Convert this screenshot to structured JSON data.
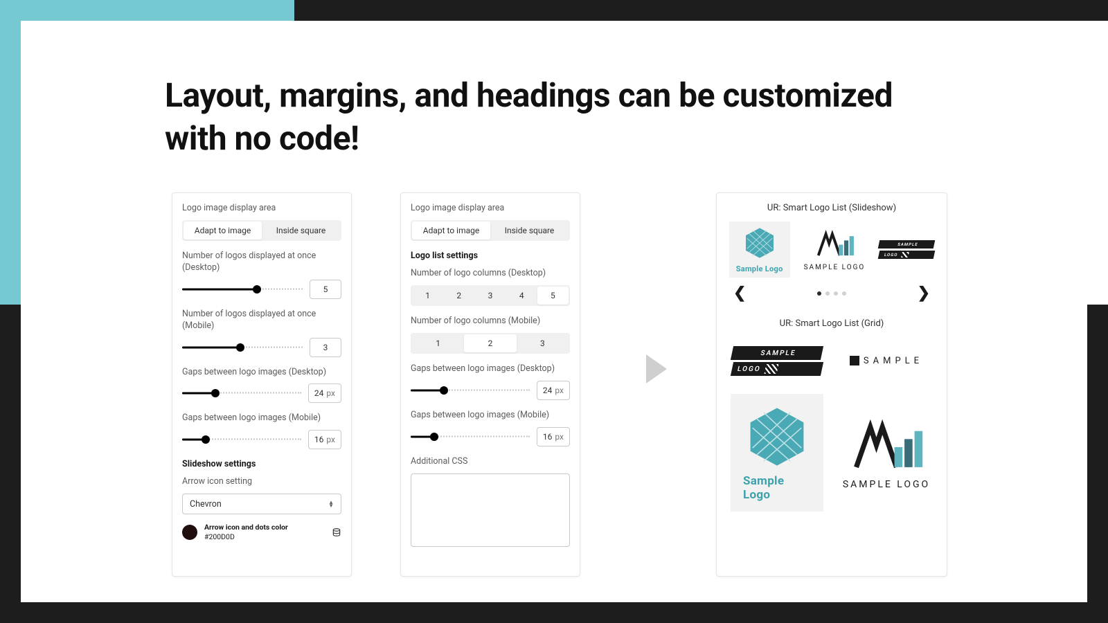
{
  "headline": "Layout, margins, and headings can be customized with no code!",
  "panel1": {
    "display_area_label": "Logo image display area",
    "seg_adapt": "Adapt to image",
    "seg_square": "Inside square",
    "num_desktop_label": "Number of logos displayed at once (Desktop)",
    "num_desktop_value": "5",
    "num_mobile_label": "Number of logos displayed at once (Mobile)",
    "num_mobile_value": "3",
    "gaps_desktop_label": "Gaps between logo images (Desktop)",
    "gaps_desktop_value": "24",
    "gaps_mobile_label": "Gaps between logo images (Mobile)",
    "gaps_mobile_value": "16",
    "px": "px",
    "slideshow_heading": "Slideshow settings",
    "arrow_icon_label": "Arrow icon setting",
    "arrow_icon_value": "Chevron",
    "color_label": "Arrow icon and dots color",
    "color_hex": "#200D0D"
  },
  "panel2": {
    "display_area_label": "Logo image display area",
    "seg_adapt": "Adapt to image",
    "seg_square": "Inside square",
    "list_heading": "Logo list settings",
    "cols_desktop_label": "Number of logo columns (Desktop)",
    "cols_desktop_opts": [
      "1",
      "2",
      "3",
      "4",
      "5"
    ],
    "cols_desktop_sel": "5",
    "cols_mobile_label": "Number of logo columns (Mobile)",
    "cols_mobile_opts": [
      "1",
      "2",
      "3"
    ],
    "cols_mobile_sel": "2",
    "gaps_desktop_label": "Gaps between logo images (Desktop)",
    "gaps_desktop_value": "24",
    "gaps_mobile_label": "Gaps between logo images (Mobile)",
    "gaps_mobile_value": "16",
    "px": "px",
    "additional_css_label": "Additional CSS"
  },
  "preview": {
    "slideshow_title": "UR: Smart Logo List (Slideshow)",
    "grid_title": "UR: Smart Logo List (Grid)",
    "hex_caption": "Sample Logo",
    "bars_caption": "SAMPLE LOGO",
    "sample_upper": "SAMPLE",
    "logo_upper": "LOGO",
    "sample_spaced": "SAMPLE"
  },
  "slider_positions": {
    "p1_num_desktop": 62,
    "p1_num_mobile": 48,
    "p1_gaps_desktop": 28,
    "p1_gaps_mobile": 20,
    "p2_gaps_desktop": 28,
    "p2_gaps_mobile": 20
  }
}
